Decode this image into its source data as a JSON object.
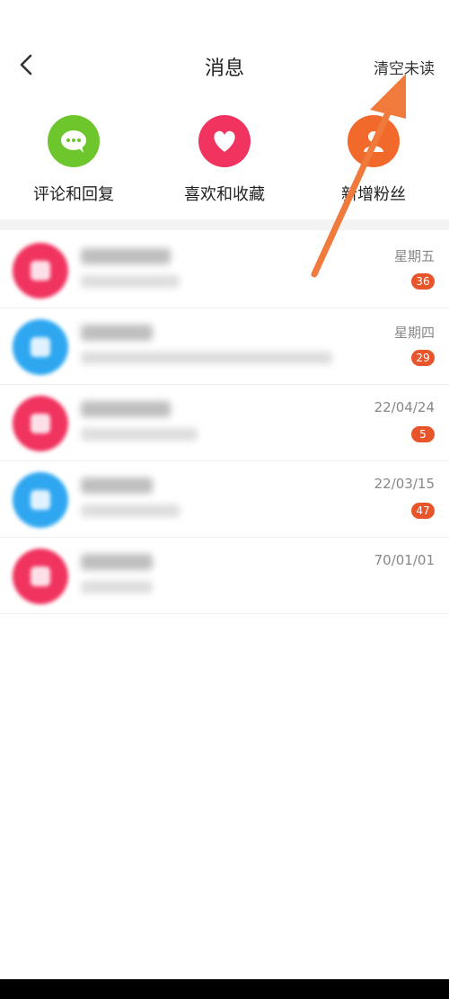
{
  "header": {
    "title": "消息",
    "clear_label": "清空未读"
  },
  "quick_actions": [
    {
      "label": "评论和回复",
      "icon": "chat-bubble-icon",
      "color": "#6cc62c"
    },
    {
      "label": "喜欢和收藏",
      "icon": "heart-icon",
      "color": "#f0335f"
    },
    {
      "label": "新增粉丝",
      "icon": "follower-icon",
      "color": "#f26a2b"
    }
  ],
  "messages": [
    {
      "time": "星期五",
      "badge": "36",
      "avatar_color": "#f0335f"
    },
    {
      "time": "星期四",
      "badge": "29",
      "avatar_color": "#2ea7f0"
    },
    {
      "time": "22/04/24",
      "badge": "5",
      "avatar_color": "#f0335f"
    },
    {
      "time": "22/03/15",
      "badge": "47",
      "avatar_color": "#2ea7f0"
    },
    {
      "time": "70/01/01",
      "badge": "",
      "avatar_color": "#f0335f"
    }
  ],
  "annotation": {
    "arrow_color": "#f07a3c"
  }
}
